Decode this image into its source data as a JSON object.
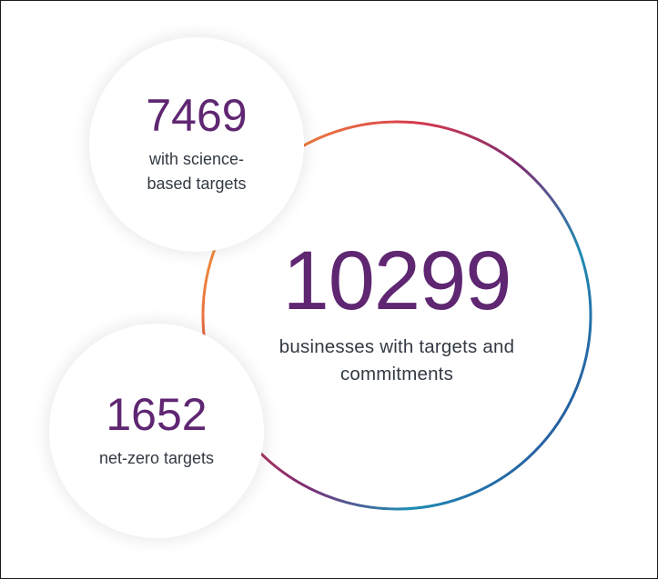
{
  "main_stat": {
    "number": "10299",
    "caption_line1": "businesses with targets and",
    "caption_line2": "commitments"
  },
  "top_bubble": {
    "number": "7469",
    "caption_line1": "with science-",
    "caption_line2": "based targets"
  },
  "bottom_bubble": {
    "number": "1652",
    "caption": "net-zero targets"
  },
  "colors": {
    "number_purple": "#5f2672",
    "caption_gray": "#333a44",
    "ring_orange": "#f08a3c",
    "ring_red": "#d8394b",
    "ring_purple": "#7b2e74",
    "ring_teal": "#1f8db3",
    "ring_blue": "#27589e"
  }
}
